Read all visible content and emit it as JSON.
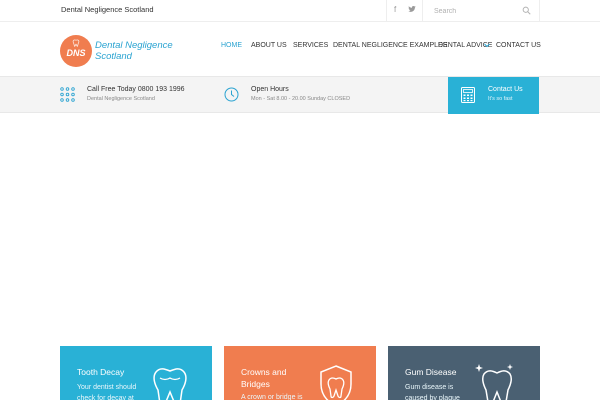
{
  "topbar": {
    "site_name": "Dental Negligence Scotland",
    "social": [
      {
        "icon": "facebook-icon",
        "glyph": "f"
      },
      {
        "icon": "twitter-icon",
        "glyph": "🐦"
      }
    ],
    "search_placeholder": "Search"
  },
  "logo": {
    "abbr": "DNS",
    "text_line1": "Dental Negligence",
    "text_line2": "Scotland"
  },
  "nav": {
    "items": [
      {
        "label": "HOME",
        "active": true
      },
      {
        "label": "ABOUT US"
      },
      {
        "label": "SERVICES"
      },
      {
        "label": "DENTAL NEGLIGENCE EXAMPLES"
      },
      {
        "label": "DENTAL ADVICE"
      },
      {
        "label": "CONTACT US"
      }
    ]
  },
  "info": {
    "call_title": "Call Free Today 0800 193 1996",
    "call_sub": "Dental Negligence Scotland",
    "hours_title": "Open Hours",
    "hours_sub": "Mon - Sat 8.00 - 20.00 Sunday CLOSED",
    "contact_title": "Contact Us",
    "contact_sub": "It's so fast"
  },
  "cards": [
    {
      "title": "Tooth Decay",
      "text": "Your dentist should check for decay at",
      "color": "#29b1d6"
    },
    {
      "title": "Crowns and Bridges",
      "text": "A crown or bridge is",
      "color": "#f07d4f"
    },
    {
      "title": "Gum Disease",
      "text": "Gum disease is caused by plaque",
      "color": "#4a6072"
    }
  ],
  "colors": {
    "accent": "#2aa3d1",
    "orange": "#f07d4f",
    "contact_bg": "#29b1d6"
  }
}
